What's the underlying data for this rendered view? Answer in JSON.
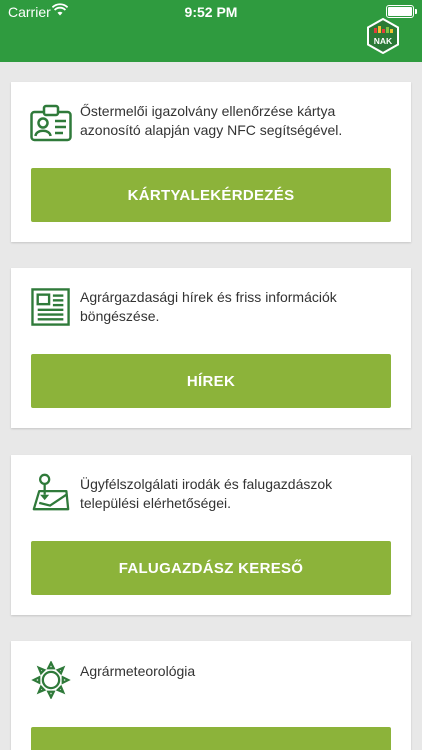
{
  "status_bar": {
    "carrier": "Carrier",
    "time": "9:52 PM"
  },
  "header": {
    "logo_text": "NAK"
  },
  "cards": [
    {
      "icon": "id-card-icon",
      "text": "Őstermelői igazolvány ellenőrzése kártya azonosító alapján vagy NFC segítségével.",
      "button": "KÁRTYALEKÉRDEZÉS"
    },
    {
      "icon": "newspaper-icon",
      "text": "Agrárgazdasági hírek és friss információk böngészése.",
      "button": "HÍREK"
    },
    {
      "icon": "map-pin-icon",
      "text": "Ügyfélszolgálati irodák és falugazdászok települési elérhetőségei.",
      "button": "FALUGAZDÁSZ KERESŐ"
    },
    {
      "icon": "sun-icon",
      "text": "Agrármeteorológia",
      "button": ""
    }
  ],
  "colors": {
    "header": "#2f9b3f",
    "button": "#8cb33a",
    "icon": "#2f7a3a"
  }
}
